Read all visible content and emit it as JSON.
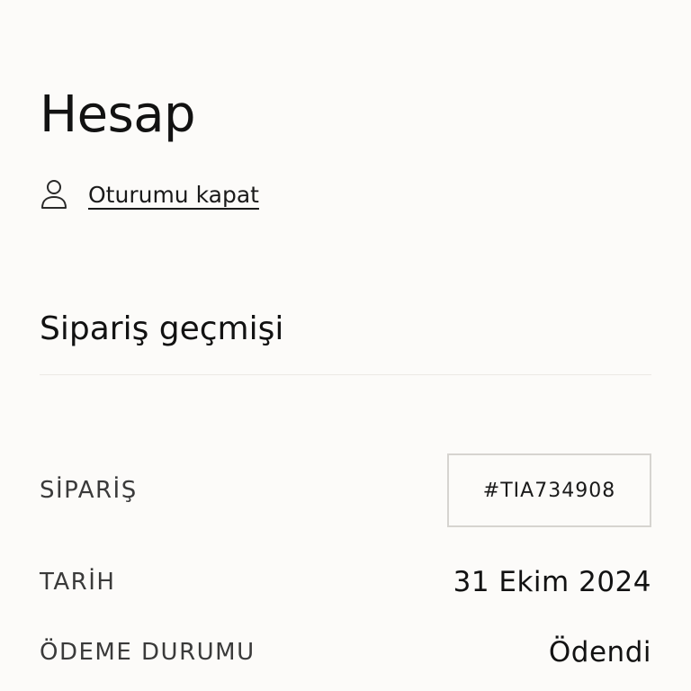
{
  "account": {
    "title": "Hesap",
    "logout_label": "Oturumu kapat",
    "logout_icon": "user-icon"
  },
  "order_history": {
    "title": "Sipariş geçmişi",
    "order": {
      "label": "SİPARİŞ",
      "number": "#TIA734908"
    },
    "date": {
      "label": "TARİH",
      "value": "31 Ekim 2024"
    },
    "payment_status": {
      "label": "ÖDEME DURUMU",
      "value": "Ödendi"
    }
  },
  "colors": {
    "background": "#fcfbf9",
    "text": "#121212",
    "border": "#d6d4d0",
    "divider": "#ebe9e5"
  }
}
